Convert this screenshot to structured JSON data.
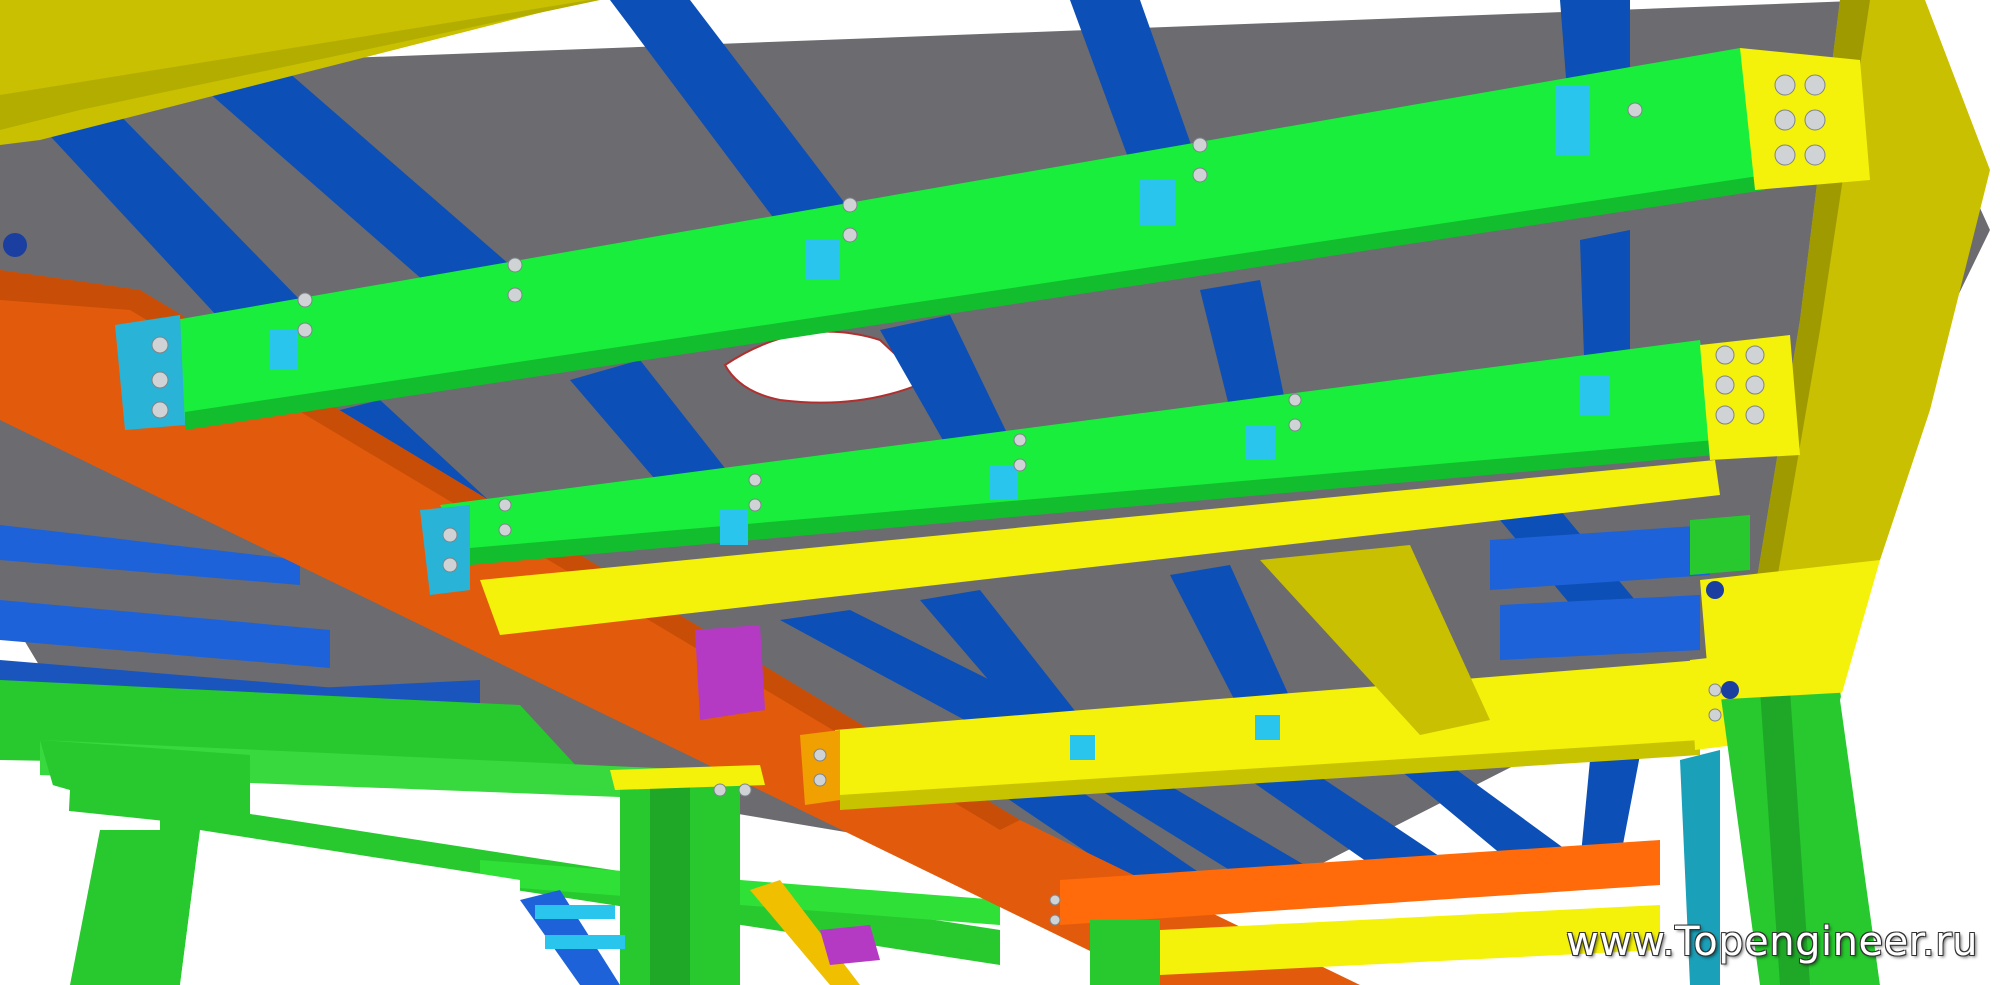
{
  "image": {
    "subject": "steel-frame",
    "watermark": "www.Topengineer.ru"
  },
  "colors": {
    "background": "#ffffff",
    "deck": "#6b6b70",
    "main_beam_yellow_olive": "#c8c000",
    "secondary_beam_green": "#19ee3c",
    "joist_blue": "#0c4fb6",
    "girder_orange": "#e25b0c",
    "edge_beam_yellow": "#f4f10a",
    "column_green": "#27c92e",
    "bracket_cyan": "#29c5ec",
    "hanger_magenta": "#b43ac4",
    "bolt": "#cfd3d6"
  }
}
